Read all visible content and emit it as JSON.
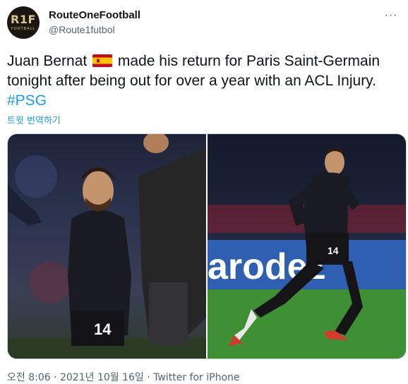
{
  "author": {
    "display_name": "RouteOneFootball",
    "handle": "@Route1futbol",
    "avatar_text": "R1F",
    "avatar_subtext": "FOOTBALL"
  },
  "tweet": {
    "text_part1": "Juan Bernat ",
    "flag_icon": "spain-flag-icon",
    "text_part2": " made his return for Paris Saint-Germain tonight after being out for over a year with an ACL Injury. ",
    "hashtag": "#PSG",
    "translate_label": "트윗 번역하기"
  },
  "media": {
    "left_photo": {
      "shirt_number": "14"
    },
    "right_photo": {
      "shirt_number": "14",
      "board_text": "arodez"
    }
  },
  "meta": {
    "time": "오전 8:06",
    "separator1": " · ",
    "date": "2021년 10월 16일",
    "separator2": " · ",
    "source": "Twitter for iPhone"
  },
  "colors": {
    "link": "#1d9bf0",
    "secondary_text": "#536471",
    "primary_text": "#0f1419"
  }
}
